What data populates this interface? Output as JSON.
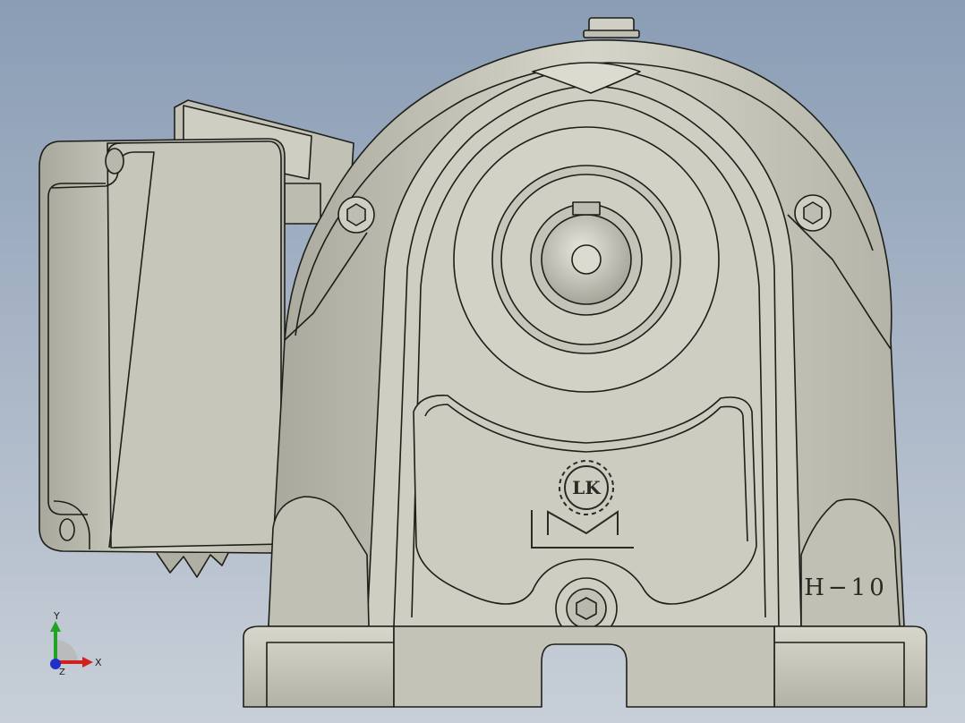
{
  "viewport": {
    "background_top": "#8a9db5",
    "background_bottom": "#c8cfd8"
  },
  "model": {
    "part_label": "H−10",
    "logo_text": "LK",
    "logo_mark": "LM",
    "body_color": "#c9c8bd",
    "edge_color": "#1f1f1a"
  },
  "triad": {
    "x_label": "X",
    "y_label": "Y",
    "z_label": "Z",
    "x_color": "#d21f1f",
    "y_color": "#23a323",
    "z_color": "#2030c8"
  }
}
